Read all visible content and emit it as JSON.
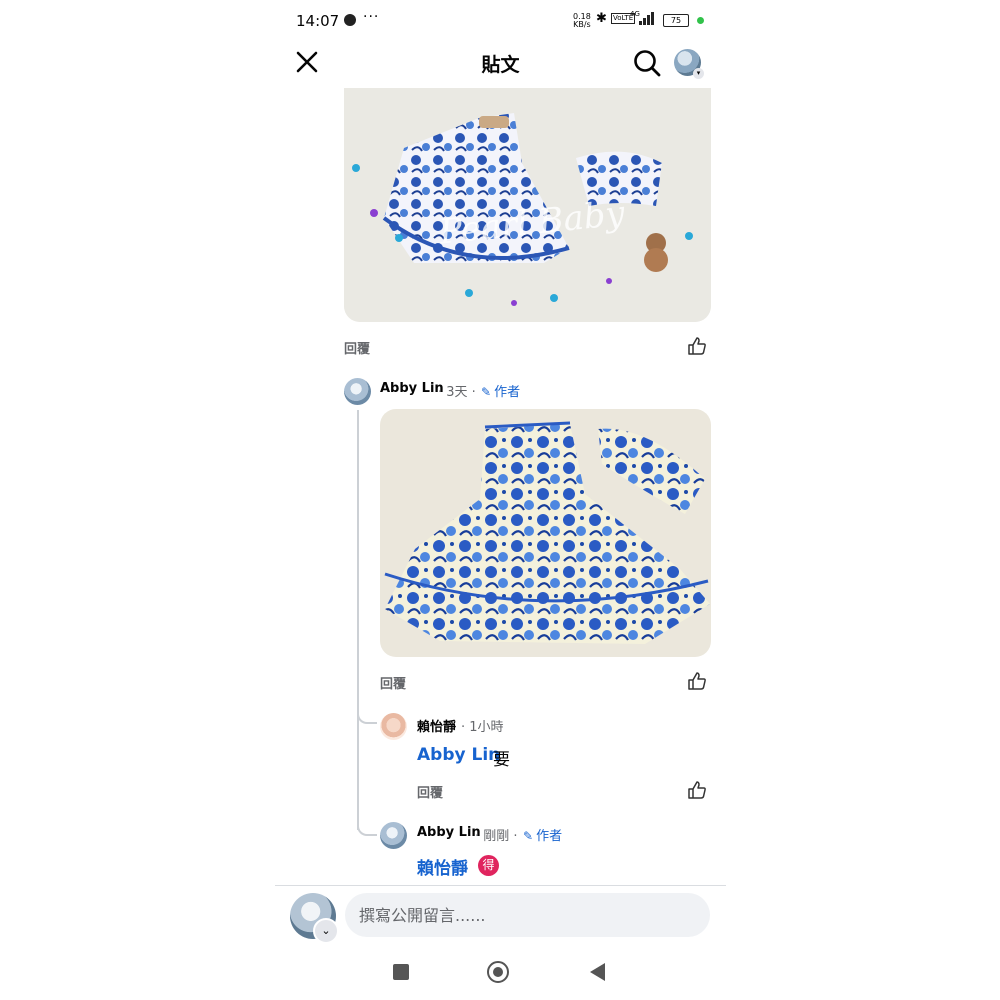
{
  "status_bar": {
    "time": "14:07",
    "dots": "···",
    "speed_value": "0.18",
    "speed_unit": "KB/s",
    "bluetooth": "✱",
    "volte": "VoLTE",
    "network": "4G",
    "battery": "75",
    "colors": {
      "dot": "#31c24a"
    }
  },
  "header": {
    "title": "貼文",
    "icons": [
      "close-icon",
      "search-icon",
      "profile-avatar"
    ]
  },
  "post": {
    "image1_watermark": "Pearl Baby",
    "reply_label": "回覆"
  },
  "comments": [
    {
      "name": "Abby Lin",
      "time": "· 3天 ·",
      "author_label": "作者",
      "reply_label": "回覆"
    },
    {
      "name": "賴怡靜",
      "time": "· 1小時",
      "mention": "Abby Lin",
      "text": "要",
      "reply_label": "回覆"
    },
    {
      "name": "Abby Lin",
      "time": "· 剛剛 ·",
      "author_label": "作者",
      "mention": "賴怡靜",
      "badge": "得"
    }
  ],
  "composer": {
    "placeholder": "撰寫公開留言......"
  },
  "colors": {
    "link": "#1763cf",
    "secondary_text": "#65676b",
    "badge": "#e0245e"
  }
}
